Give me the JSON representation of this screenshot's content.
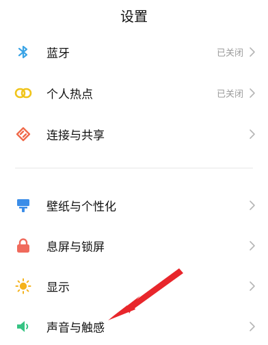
{
  "header": {
    "title": "设置"
  },
  "group1": [
    {
      "label": "蓝牙",
      "status": "已关闭",
      "icon": "bluetooth-icon"
    },
    {
      "label": "个人热点",
      "status": "已关闭",
      "icon": "hotspot-icon"
    },
    {
      "label": "连接与共享",
      "status": "",
      "icon": "connection-sharing-icon"
    }
  ],
  "group2": [
    {
      "label": "壁纸与个性化",
      "icon": "wallpaper-icon"
    },
    {
      "label": "息屏与锁屏",
      "icon": "lock-icon"
    },
    {
      "label": "显示",
      "icon": "display-sun-icon"
    },
    {
      "label": "声音与触感",
      "icon": "sound-speaker-icon"
    }
  ],
  "colors": {
    "bluetooth": "#3aa4e6",
    "hotspot": "#f0c419",
    "connection": "#f06a4a",
    "wallpaper": "#3b8de8",
    "lock": "#f06a5c",
    "display": "#f5b21b",
    "sound": "#36c383",
    "annotation_arrow": "#e8262b"
  }
}
